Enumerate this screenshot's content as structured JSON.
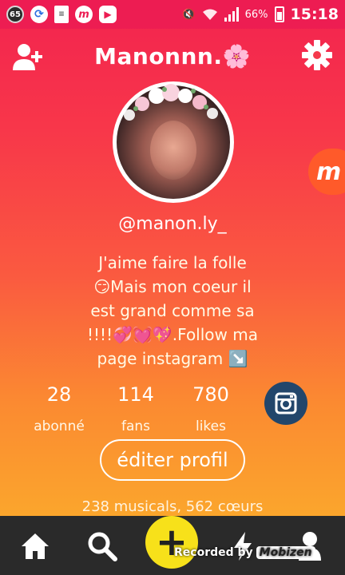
{
  "status_bar": {
    "notification_count": "65",
    "battery_percent": "66%",
    "time": "15:18"
  },
  "header": {
    "title": "Manonnn.🌸"
  },
  "profile": {
    "username": "@manon.ly_",
    "bio_lines": [
      "J'aime faire la folle",
      "😏Mais mon coeur il",
      "est grand comme sa",
      "!!!!💞💓💖.Follow ma",
      "page instagram ↘️"
    ]
  },
  "side_badge": {
    "letter": "m"
  },
  "stats": [
    {
      "value": "28",
      "label": "abonné"
    },
    {
      "value": "114",
      "label": "fans"
    },
    {
      "value": "780",
      "label": "likes"
    }
  ],
  "edit_profile_label": "éditer profil",
  "summary": "238 musicals, 562 cœurs",
  "bottom_nav": {
    "items": [
      "home-icon",
      "search-icon",
      "create-icon",
      "notifications-icon",
      "profile-icon"
    ],
    "create_label": "+"
  },
  "watermark": {
    "text": "Recorded by",
    "brand": "Mobizen"
  },
  "colors": {
    "gradient_top": "#f2234f",
    "gradient_bottom": "#fbb42a",
    "nav_bg": "#2a2a2a",
    "create_yellow": "#f7e11a",
    "instagram_bg": "#22466b"
  }
}
